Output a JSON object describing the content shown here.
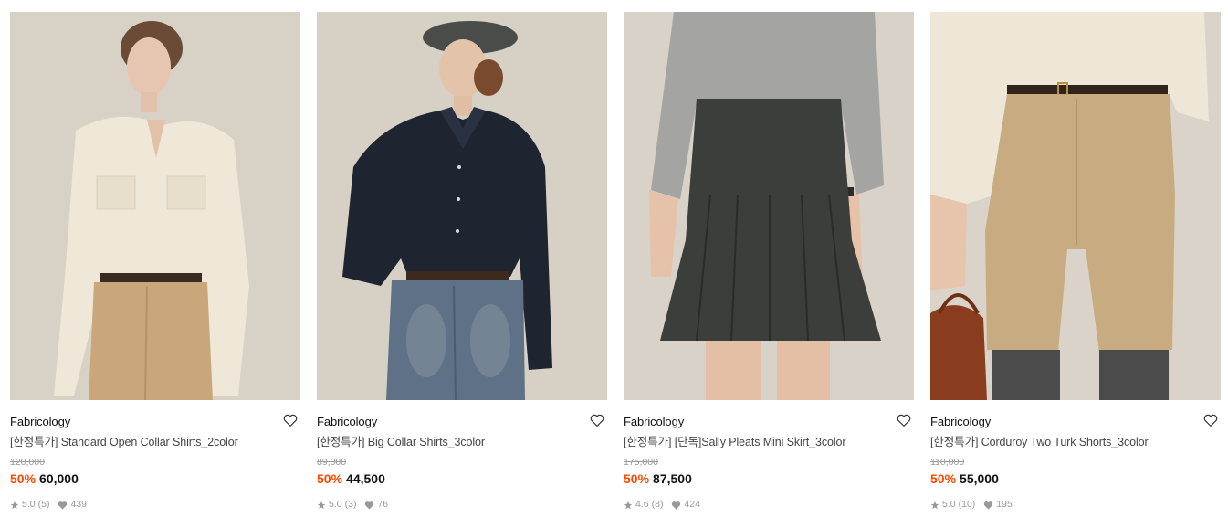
{
  "products": [
    {
      "brand": "Fabricology",
      "name": "[한정특가] Standard Open Collar Shirts_2color",
      "original_price": "120,000",
      "discount": "50%",
      "price": "60,000",
      "rating": "5.0",
      "review_count": "(5)",
      "likes": "439",
      "image_icon": "product-photo-open-collar-shirt",
      "bg": "#d8d1c6"
    },
    {
      "brand": "Fabricology",
      "name": "[한정특가] Big Collar Shirts_3color",
      "original_price": "89,000",
      "discount": "50%",
      "price": "44,500",
      "rating": "5.0",
      "review_count": "(3)",
      "likes": "76",
      "image_icon": "product-photo-big-collar-shirt",
      "bg": "#d6d0c5"
    },
    {
      "brand": "Fabricology",
      "name": "[한정특가] [단독]Sally Pleats Mini Skirt_3color",
      "original_price": "175,000",
      "discount": "50%",
      "price": "87,500",
      "rating": "4.6",
      "review_count": "(8)",
      "likes": "424",
      "image_icon": "product-photo-pleats-mini-skirt",
      "bg": "#d8d2c8"
    },
    {
      "brand": "Fabricology",
      "name": "[한정특가] Corduroy Two Turk Shorts_3color",
      "original_price": "110,000",
      "discount": "50%",
      "price": "55,000",
      "rating": "5.0",
      "review_count": "(10)",
      "likes": "195",
      "image_icon": "product-photo-corduroy-shorts",
      "bg": "#d9d3c9"
    }
  ],
  "colors": {
    "discount": "#ff4800",
    "text": "#111111",
    "muted": "#999999",
    "name": "#444444"
  },
  "icons": {
    "wishlist": "heart-outline-icon",
    "rating": "star-icon",
    "likes": "heart-icon"
  }
}
